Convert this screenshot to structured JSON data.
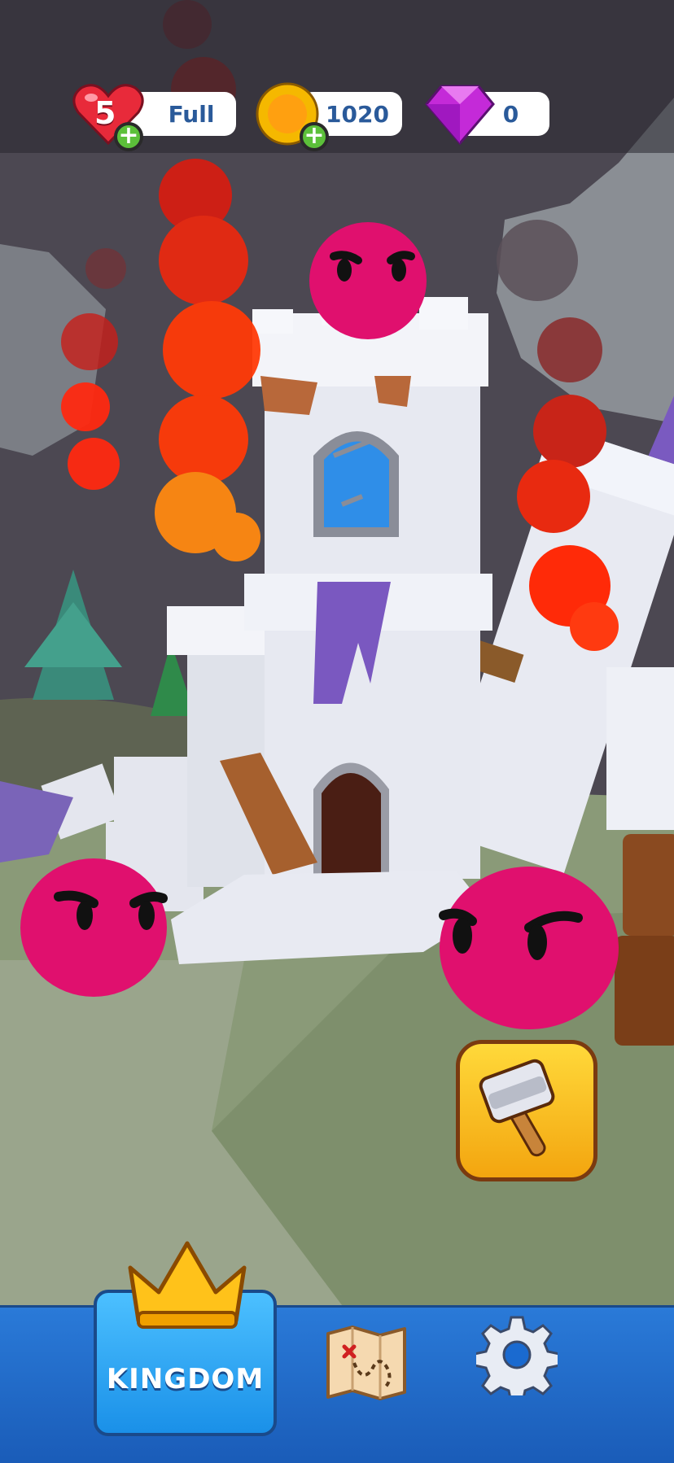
{
  "hud": {
    "lives": {
      "count": "5",
      "status": "Full",
      "icon": "heart-icon"
    },
    "coins": {
      "value": "1020",
      "icon": "coin-icon"
    },
    "gems": {
      "value": "0",
      "icon": "gem-icon"
    },
    "add_symbol": "+"
  },
  "actions": {
    "hammer": {
      "icon": "hammer-icon"
    }
  },
  "nav": {
    "kingdom": {
      "label": "KINGDOM",
      "icon": "crown-icon"
    },
    "map": {
      "icon": "treasure-map-icon"
    },
    "settings": {
      "icon": "gear-icon"
    }
  },
  "colors": {
    "nav_blue": "#1a6ad0",
    "kingdom_button": "#2aa6f5",
    "hammer_button": "#f8c020",
    "slime": "#e0106e",
    "fire": "#ff3a10"
  }
}
